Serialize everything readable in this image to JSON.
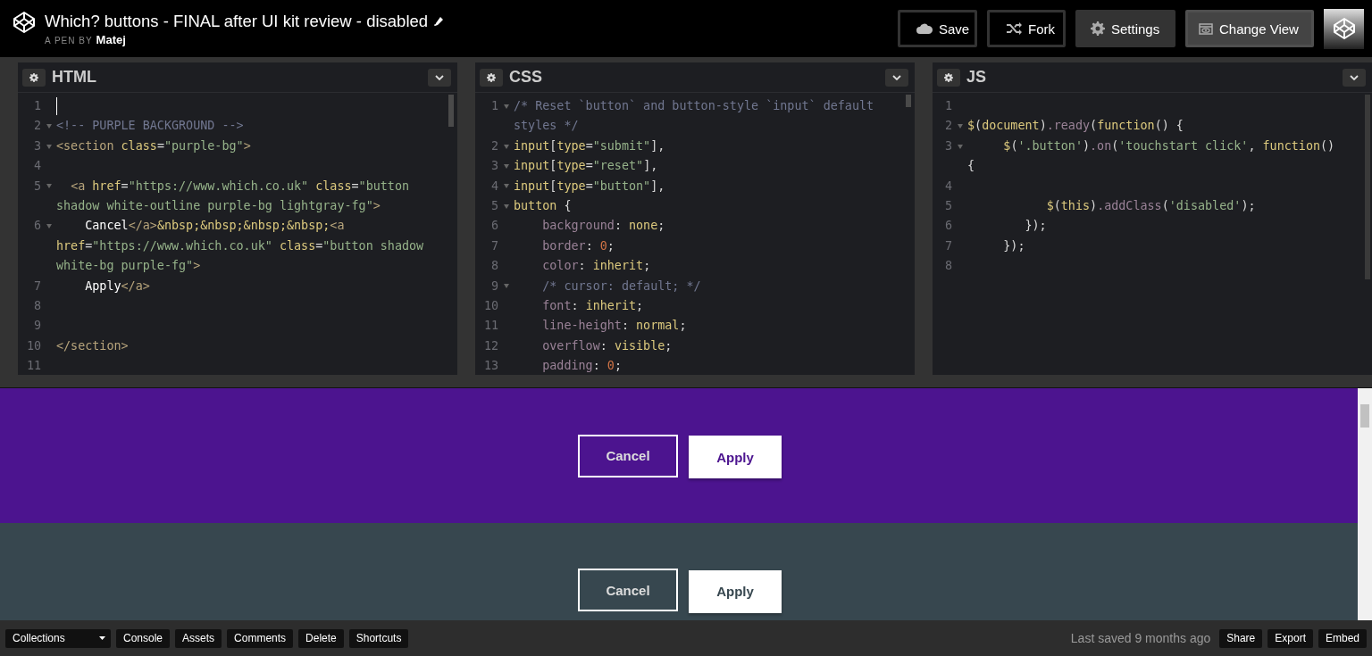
{
  "header": {
    "title": "Which? buttons - FINAL after UI kit review - disabled",
    "byline_prefix": "A PEN BY",
    "author": "Matej",
    "buttons": [
      {
        "label": "Save",
        "kind": "save"
      },
      {
        "label": "Fork",
        "kind": "fork"
      },
      {
        "label": "Settings",
        "kind": "settings"
      },
      {
        "label": "Change View",
        "kind": "view"
      }
    ]
  },
  "editors": [
    {
      "title": "HTML",
      "lines": [
        {
          "number": "1",
          "fold": false,
          "cursor": true
        },
        {
          "number": "2",
          "fold": true,
          "cursor": false,
          "tokens": [
            {
              "kind": "comment",
              "text": "<!-- PURPLE BACKGROUND -->"
            }
          ]
        },
        {
          "number": "3",
          "fold": true,
          "cursor": false,
          "tokens": [
            {
              "kind": "tag",
              "text": "<section "
            },
            {
              "kind": "attr",
              "text": "class"
            },
            {
              "kind": "punct",
              "text": "="
            },
            {
              "kind": "string",
              "text": "\"purple-bg\""
            },
            {
              "kind": "tag",
              "text": ">"
            }
          ]
        },
        {
          "number": "4",
          "fold": false,
          "cursor": false
        },
        {
          "number": "5",
          "fold": true,
          "cursor": false,
          "tokens": [
            {
              "kind": "tag",
              "text": "  <a "
            },
            {
              "kind": "attr",
              "text": "href"
            },
            {
              "kind": "punct",
              "text": "="
            },
            {
              "kind": "string",
              "text": "\"https://www.which.co.uk\" "
            },
            {
              "kind": "attr",
              "text": "class"
            },
            {
              "kind": "punct",
              "text": "="
            },
            {
              "kind": "string",
              "text": "\"button shadow white-outline purple-bg lightgray-fg\""
            },
            {
              "kind": "tag",
              "text": ">"
            }
          ]
        },
        {
          "number": "6",
          "fold": true,
          "cursor": false,
          "tokens": [
            {
              "kind": "text",
              "text": "    Cancel"
            },
            {
              "kind": "tag",
              "text": "</a>"
            },
            {
              "kind": "attr",
              "text": "&nbsp;&nbsp;&nbsp;&nbsp;"
            },
            {
              "kind": "tag",
              "text": "<a "
            },
            {
              "kind": "attr",
              "text": "href"
            },
            {
              "kind": "punct",
              "text": "="
            },
            {
              "kind": "string",
              "text": "\"https://www.which.co.uk\" "
            },
            {
              "kind": "attr",
              "text": "class"
            },
            {
              "kind": "punct",
              "text": "="
            },
            {
              "kind": "string",
              "text": "\"button shadow white-bg purple-fg\""
            },
            {
              "kind": "tag",
              "text": ">"
            }
          ]
        },
        {
          "number": "7",
          "fold": false,
          "cursor": false,
          "tokens": [
            {
              "kind": "text",
              "text": "    Apply"
            },
            {
              "kind": "tag",
              "text": "</a>"
            }
          ]
        },
        {
          "number": "8",
          "fold": false,
          "cursor": false
        },
        {
          "number": "9",
          "fold": false,
          "cursor": false
        },
        {
          "number": "10",
          "fold": false,
          "cursor": false,
          "tokens": [
            {
              "kind": "tag",
              "text": "</section>"
            }
          ]
        },
        {
          "number": "11",
          "fold": false,
          "cursor": false
        }
      ]
    },
    {
      "title": "CSS",
      "lines": [
        {
          "number": "1",
          "fold": true,
          "tokens": [
            {
              "kind": "comment",
              "text": "/* Reset `button` and button-style `input` default styles */"
            }
          ]
        },
        {
          "number": "2",
          "fold": true,
          "tokens": [
            {
              "kind": "value",
              "text": "input"
            },
            {
              "kind": "punct",
              "text": "["
            },
            {
              "kind": "value",
              "text": "type"
            },
            {
              "kind": "punct",
              "text": "="
            },
            {
              "kind": "string",
              "text": "\"submit\""
            },
            {
              "kind": "punct",
              "text": "],"
            }
          ]
        },
        {
          "number": "3",
          "fold": true,
          "tokens": [
            {
              "kind": "value",
              "text": "input"
            },
            {
              "kind": "punct",
              "text": "["
            },
            {
              "kind": "value",
              "text": "type"
            },
            {
              "kind": "punct",
              "text": "="
            },
            {
              "kind": "string",
              "text": "\"reset\""
            },
            {
              "kind": "punct",
              "text": "],"
            }
          ]
        },
        {
          "number": "4",
          "fold": true,
          "tokens": [
            {
              "kind": "value",
              "text": "input"
            },
            {
              "kind": "punct",
              "text": "["
            },
            {
              "kind": "value",
              "text": "type"
            },
            {
              "kind": "punct",
              "text": "="
            },
            {
              "kind": "string",
              "text": "\"button\""
            },
            {
              "kind": "punct",
              "text": "],"
            }
          ]
        },
        {
          "number": "5",
          "fold": true,
          "tokens": [
            {
              "kind": "value",
              "text": "button"
            },
            {
              "kind": "punct",
              "text": " {"
            }
          ]
        },
        {
          "number": "6",
          "fold": false,
          "tokens": [
            {
              "kind": "prop",
              "text": "    background"
            },
            {
              "kind": "punct",
              "text": ": "
            },
            {
              "kind": "value",
              "text": "none"
            },
            {
              "kind": "punct",
              "text": ";"
            }
          ]
        },
        {
          "number": "7",
          "fold": false,
          "tokens": [
            {
              "kind": "prop",
              "text": "    border"
            },
            {
              "kind": "punct",
              "text": ": "
            },
            {
              "kind": "number",
              "text": "0"
            },
            {
              "kind": "punct",
              "text": ";"
            }
          ]
        },
        {
          "number": "8",
          "fold": false,
          "tokens": [
            {
              "kind": "prop",
              "text": "    color"
            },
            {
              "kind": "punct",
              "text": ": "
            },
            {
              "kind": "value",
              "text": "inherit"
            },
            {
              "kind": "punct",
              "text": ";"
            }
          ]
        },
        {
          "number": "9",
          "fold": true,
          "tokens": [
            {
              "kind": "comment",
              "text": "    /* cursor: default; */"
            }
          ]
        },
        {
          "number": "10",
          "fold": false,
          "tokens": [
            {
              "kind": "prop",
              "text": "    font"
            },
            {
              "kind": "punct",
              "text": ": "
            },
            {
              "kind": "value",
              "text": "inherit"
            },
            {
              "kind": "punct",
              "text": ";"
            }
          ]
        },
        {
          "number": "11",
          "fold": false,
          "tokens": [
            {
              "kind": "prop",
              "text": "    line-height"
            },
            {
              "kind": "punct",
              "text": ": "
            },
            {
              "kind": "value",
              "text": "normal"
            },
            {
              "kind": "punct",
              "text": ";"
            }
          ]
        },
        {
          "number": "12",
          "fold": false,
          "tokens": [
            {
              "kind": "prop",
              "text": "    overflow"
            },
            {
              "kind": "punct",
              "text": ": "
            },
            {
              "kind": "value",
              "text": "visible"
            },
            {
              "kind": "punct",
              "text": ";"
            }
          ]
        },
        {
          "number": "13",
          "fold": false,
          "tokens": [
            {
              "kind": "prop",
              "text": "    padding"
            },
            {
              "kind": "punct",
              "text": ": "
            },
            {
              "kind": "number",
              "text": "0"
            },
            {
              "kind": "punct",
              "text": ";"
            }
          ]
        }
      ]
    },
    {
      "title": "JS",
      "lines": [
        {
          "number": "1",
          "fold": false
        },
        {
          "number": "2",
          "fold": true,
          "tokens": [
            {
              "kind": "value",
              "text": "$"
            },
            {
              "kind": "punct",
              "text": "("
            },
            {
              "kind": "value",
              "text": "document"
            },
            {
              "kind": "punct",
              "text": ")"
            },
            {
              "kind": "prop",
              "text": ".ready"
            },
            {
              "kind": "punct",
              "text": "("
            },
            {
              "kind": "value",
              "text": "function"
            },
            {
              "kind": "punct",
              "text": "() {"
            }
          ]
        },
        {
          "number": "3",
          "fold": true,
          "tokens": [
            {
              "kind": "value",
              "text": "     $"
            },
            {
              "kind": "punct",
              "text": "("
            },
            {
              "kind": "string",
              "text": "'.button'"
            },
            {
              "kind": "punct",
              "text": ")"
            },
            {
              "kind": "prop",
              "text": ".on"
            },
            {
              "kind": "punct",
              "text": "("
            },
            {
              "kind": "string",
              "text": "'touchstart click'"
            },
            {
              "kind": "punct",
              "text": ", "
            },
            {
              "kind": "value",
              "text": "function"
            },
            {
              "kind": "punct",
              "text": "() {"
            }
          ]
        },
        {
          "number": "4",
          "fold": false
        },
        {
          "number": "5",
          "fold": false,
          "tokens": [
            {
              "kind": "value",
              "text": "           $"
            },
            {
              "kind": "punct",
              "text": "("
            },
            {
              "kind": "value",
              "text": "this"
            },
            {
              "kind": "punct",
              "text": ")"
            },
            {
              "kind": "prop",
              "text": ".addClass"
            },
            {
              "kind": "punct",
              "text": "("
            },
            {
              "kind": "string",
              "text": "'disabled'"
            },
            {
              "kind": "punct",
              "text": ");"
            }
          ]
        },
        {
          "number": "6",
          "fold": false,
          "tokens": [
            {
              "kind": "punct",
              "text": "        });"
            }
          ]
        },
        {
          "number": "7",
          "fold": false,
          "tokens": [
            {
              "kind": "punct",
              "text": "     });"
            }
          ]
        },
        {
          "number": "8",
          "fold": false
        }
      ]
    }
  ],
  "preview": {
    "sections": [
      {
        "kind": "purple",
        "buttons": [
          {
            "label": "Cancel",
            "kind": "outline"
          },
          {
            "label": "Apply",
            "kind": "filled"
          }
        ]
      },
      {
        "kind": "slate",
        "buttons": [
          {
            "label": "Cancel",
            "kind": "outline"
          },
          {
            "label": "Apply",
            "kind": "filled"
          }
        ]
      }
    ]
  },
  "footer": {
    "collections": "Collections",
    "left_buttons": [
      "Console",
      "Assets",
      "Comments",
      "Delete",
      "Shortcuts"
    ],
    "last_saved": "Last saved 9 months ago",
    "right_buttons": [
      "Share",
      "Export",
      "Embed"
    ]
  }
}
